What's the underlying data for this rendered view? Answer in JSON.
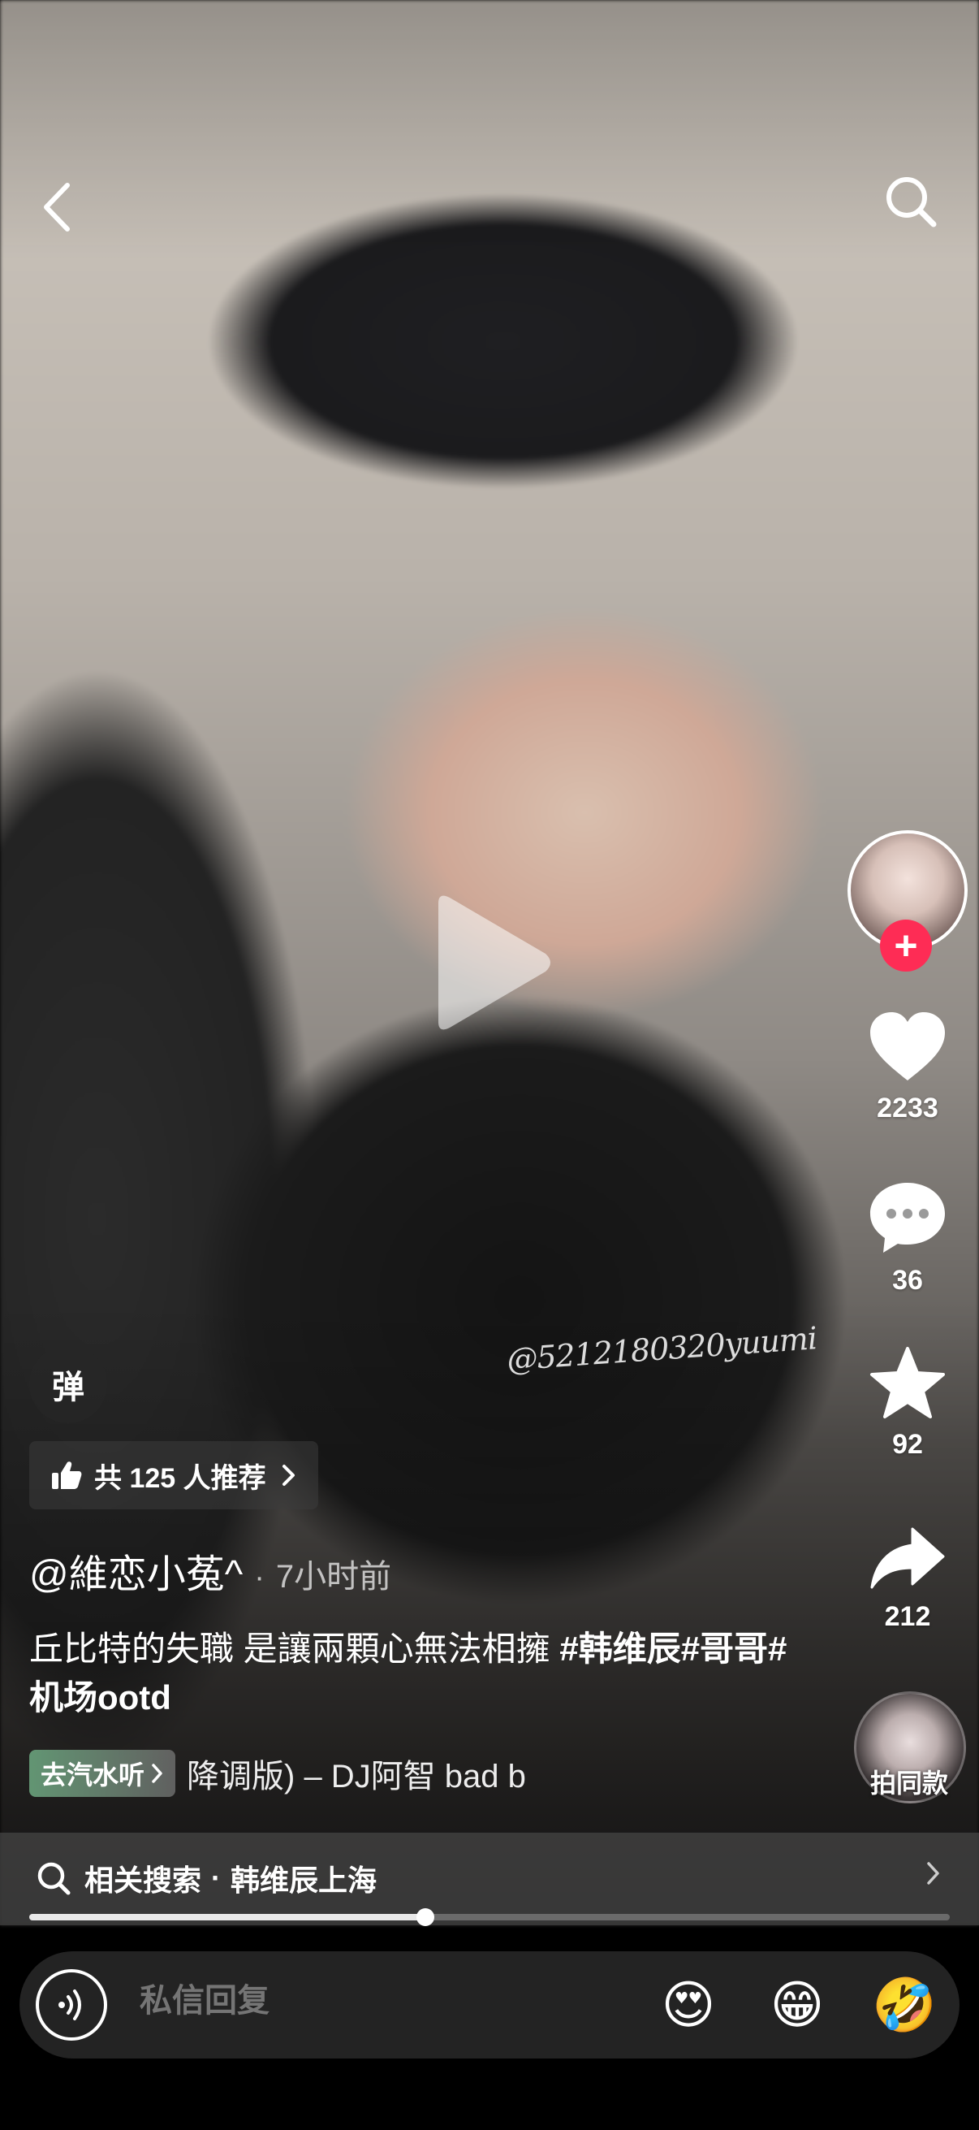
{
  "video": {
    "watermark": "@5212180320yuumi"
  },
  "nav": {
    "back_icon": "chevron-left-icon",
    "search_icon": "search-icon"
  },
  "author": {
    "follow_symbol": "+",
    "handle": "@維恋小菟^",
    "separator": "·",
    "time": "7小时前"
  },
  "actions": {
    "likes": "2233",
    "comments": "36",
    "favorites": "92",
    "shares": "212",
    "same_style": "拍同款"
  },
  "danmaku": {
    "label": "弹"
  },
  "recommend": {
    "label": "共 125 人推荐"
  },
  "caption": {
    "text": "丘比特的失職  是讓兩顆心無法相擁 ",
    "tags": "#韩维辰#哥哥#机场ootd"
  },
  "music": {
    "pill_label": "去汽水听",
    "track": "降调版) – DJ阿智    bad b"
  },
  "related_search": {
    "label": "相关搜索",
    "separator": "·",
    "query": "韩维辰上海"
  },
  "playback": {
    "progress": 0.43
  },
  "reply": {
    "placeholder": "私信回复",
    "emojis": [
      "😍",
      "😁",
      "🤣"
    ]
  },
  "colors": {
    "accent": "#fe2c55",
    "bar_bg": "#232323"
  }
}
